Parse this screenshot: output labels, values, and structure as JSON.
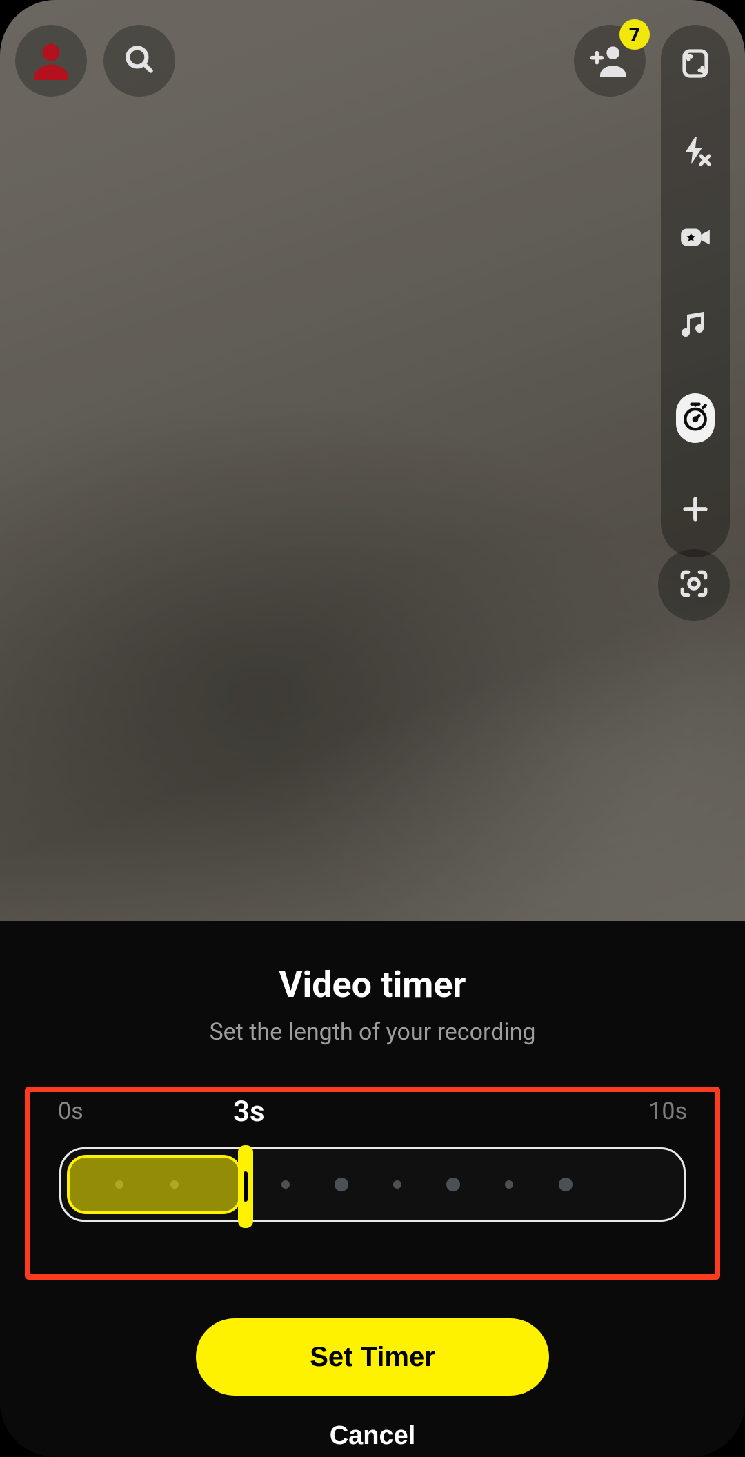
{
  "badge": {
    "count": "7"
  },
  "timer": {
    "title": "Video timer",
    "subtitle": "Set the length of your recording",
    "min_label": "0s",
    "max_label": "10s",
    "current_label": "3s",
    "min_value": 0,
    "max_value": 10,
    "current_value": 3,
    "primary_button": "Set Timer",
    "secondary_button": "Cancel"
  },
  "icons": {
    "profile": "profile-icon",
    "search": "search-icon",
    "add_friend": "add-friend-icon",
    "flip": "flip-camera-icon",
    "flash_off": "flash-off-icon",
    "video_effect": "video-effect-icon",
    "music": "music-icon",
    "timer": "stopwatch-icon",
    "plus": "plus-icon",
    "lens": "scan-icon"
  },
  "colors": {
    "accent": "#fff200",
    "highlight_border": "#ff3b1f",
    "profile": "#c1121f"
  }
}
